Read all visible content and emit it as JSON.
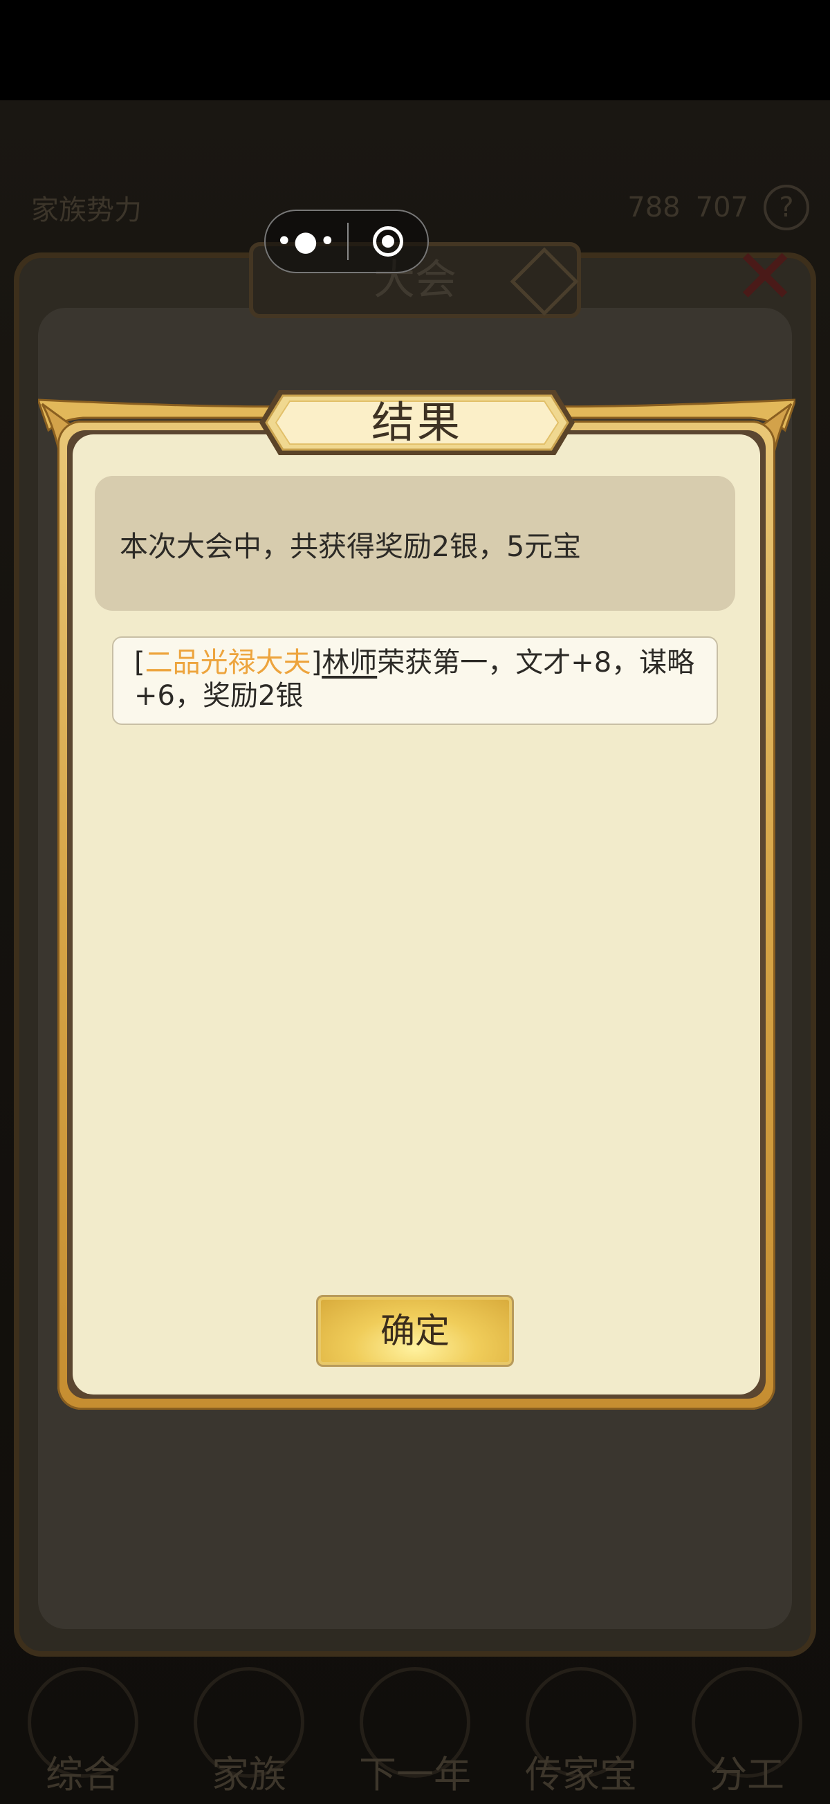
{
  "background": {
    "clan_label": "家族势力",
    "nav": [
      {
        "label": "综合",
        "icon": "overview-icon"
      },
      {
        "label": "家族",
        "icon": "clan-icon"
      },
      {
        "label": "下一年",
        "icon": "next-year-icon"
      },
      {
        "label": "传家宝",
        "icon": "heirloom-icon"
      },
      {
        "label": "分工",
        "icon": "division-icon"
      }
    ],
    "hall_title": "大会",
    "resource_values": [
      "788",
      "707"
    ]
  },
  "dialog": {
    "title": "结果",
    "summary": "本次大会中，共获得奖励2银，5元宝",
    "records": [
      {
        "bracket_open": "[",
        "rank": "二品光禄大夫",
        "bracket_close": "]",
        "name": "林师",
        "text": "荣获第一，文才+8，谋略+6，奖励2银"
      }
    ],
    "confirm_label": "确定"
  },
  "colors": {
    "rank_text": "#eda43d",
    "dialog_body": "#f2ebcb",
    "summary_bg": "#d7ccae",
    "frame_gold": "#d6a446",
    "confirm_gold": "#f0cd5a"
  }
}
